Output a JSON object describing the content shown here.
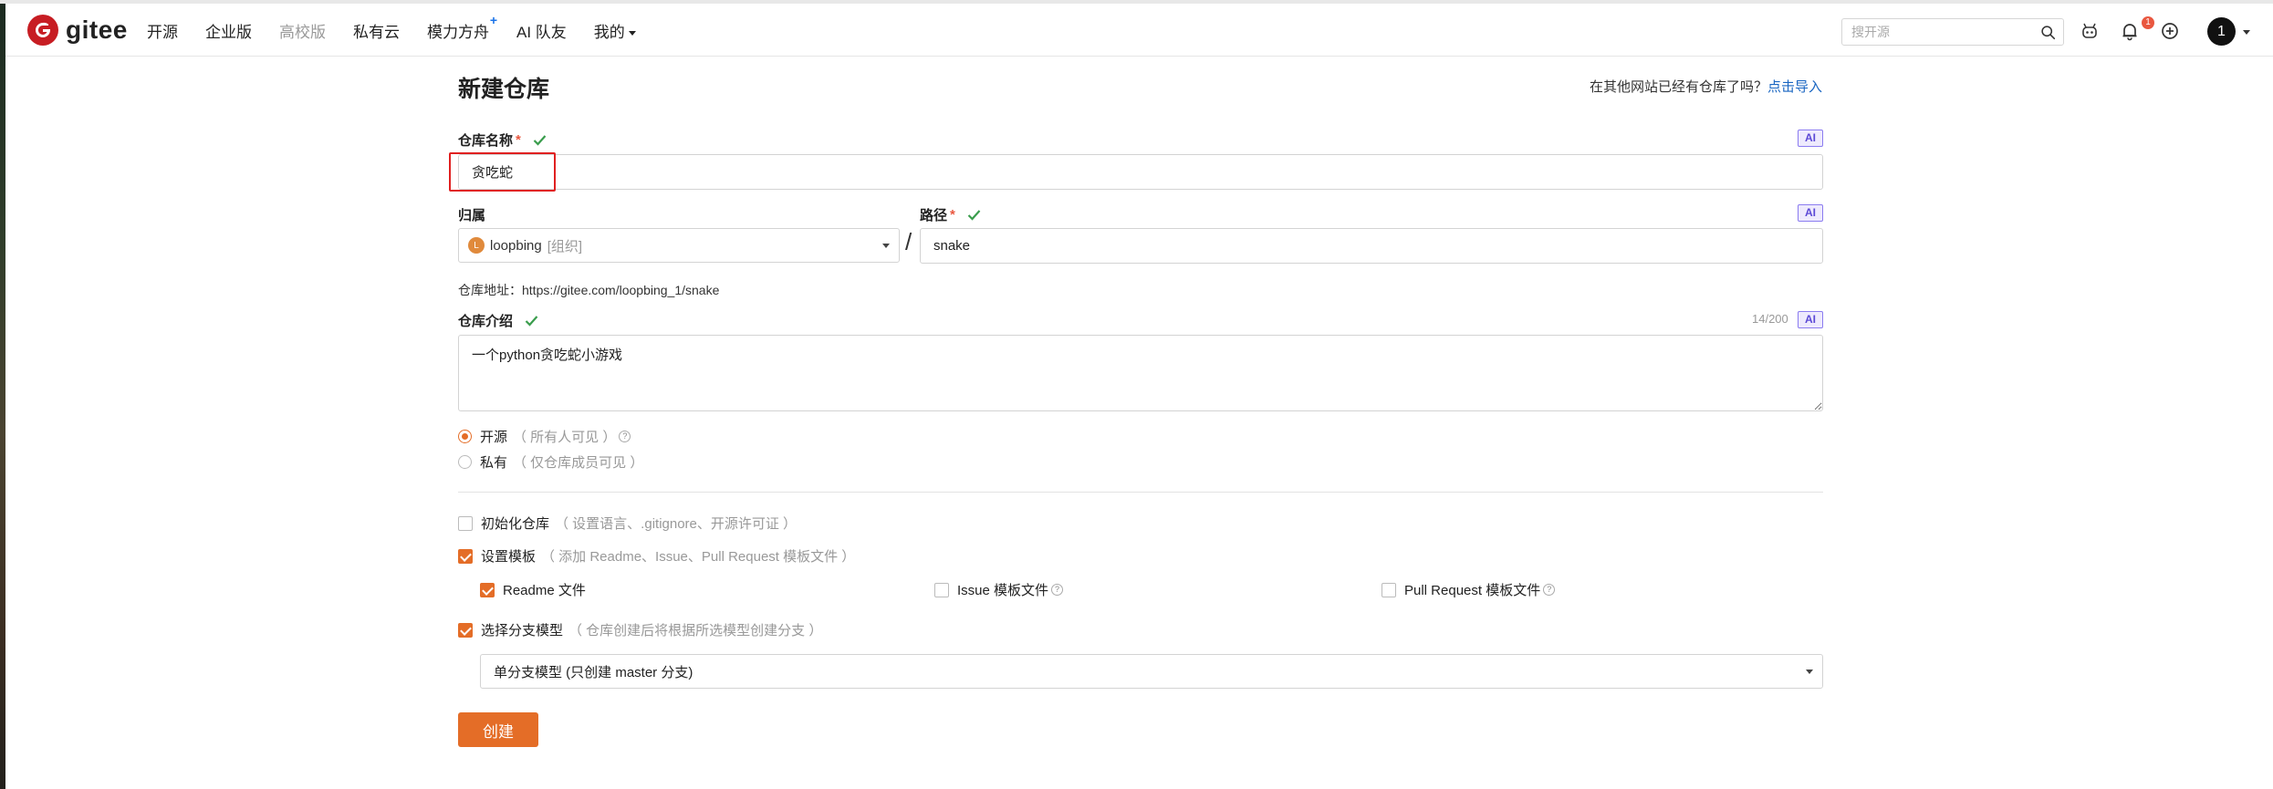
{
  "brand": {
    "name": "gitee",
    "logo_letter": "G"
  },
  "nav": {
    "items": [
      {
        "label": "开源",
        "muted": false
      },
      {
        "label": "企业版",
        "muted": false
      },
      {
        "label": "高校版",
        "muted": true
      },
      {
        "label": "私有云",
        "muted": false
      },
      {
        "label": "模力方舟",
        "muted": false,
        "badge": "+"
      },
      {
        "label": "AI 队友",
        "muted": false
      },
      {
        "label": "我的",
        "muted": false,
        "dropdown": true
      }
    ]
  },
  "header": {
    "search_placeholder": "搜开源",
    "notification_count": "1",
    "avatar_text": "1",
    "icons": [
      "search-icon",
      "robot-icon",
      "bell-icon",
      "plus-circle-icon",
      "chevron-down-icon"
    ]
  },
  "page": {
    "title": "新建仓库",
    "import_hint": "在其他网站已经有仓库了吗？",
    "import_link": "点击导入"
  },
  "form": {
    "ai_label": "AI",
    "repo_name": {
      "label": "仓库名称",
      "required": "*",
      "value": "贪吃蛇"
    },
    "owner": {
      "label": "归属",
      "avatar_letter": "L",
      "value": "loopbing",
      "tag": "[组织]"
    },
    "path": {
      "label": "路径",
      "required": "*",
      "value": "snake"
    },
    "separator": "/",
    "repo_address": "仓库地址：https://gitee.com/loopbing_1/snake",
    "description": {
      "label": "仓库介绍",
      "count": "14/200",
      "value": "一个python贪吃蛇小游戏"
    },
    "visibility": [
      {
        "label": "开源",
        "hint": "（ 所有人可见 ）",
        "selected": true,
        "has_help": true
      },
      {
        "label": "私有",
        "hint": "（ 仅仓库成员可见 ）",
        "selected": false,
        "has_help": false
      }
    ],
    "init_repo": {
      "label": "初始化仓库",
      "hint": "（ 设置语言、.gitignore、开源许可证 ）",
      "checked": false
    },
    "set_template": {
      "label": "设置模板",
      "hint": "（ 添加 Readme、Issue、Pull Request 模板文件 ）",
      "checked": true
    },
    "templates": [
      {
        "label": "Readme 文件",
        "checked": true,
        "has_help": false
      },
      {
        "label": "Issue 模板文件",
        "checked": false,
        "has_help": true
      },
      {
        "label": "Pull Request 模板文件",
        "checked": false,
        "has_help": true
      }
    ],
    "branch_model": {
      "label": "选择分支模型",
      "hint": "（ 仓库创建后将根据所选模型创建分支 ）",
      "checked": true,
      "selected": "单分支模型 (只创建 master 分支)"
    },
    "submit_label": "创建"
  },
  "colors": {
    "accent": "#e46d27",
    "brand": "#c71d23",
    "link": "#1a66c2",
    "success": "#3a9d4d",
    "highlight": "#e02020"
  }
}
